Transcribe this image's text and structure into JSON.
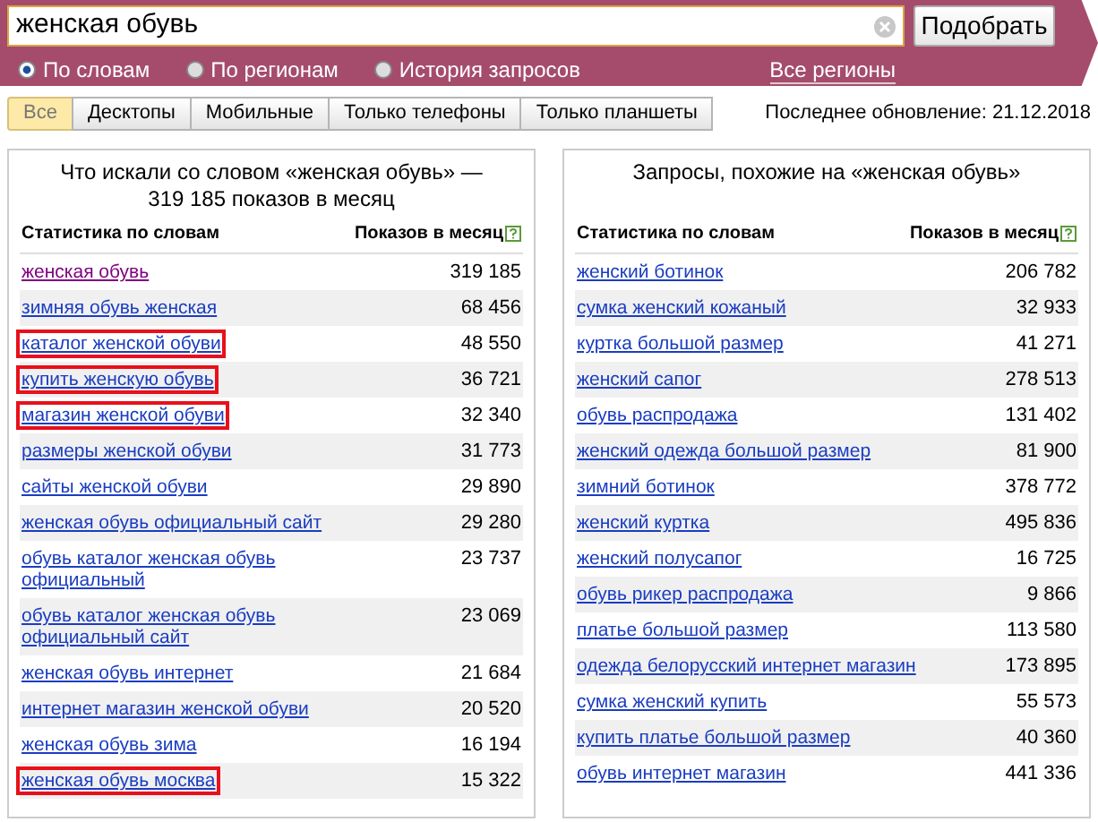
{
  "search": {
    "value": "женская обувь",
    "button": "Подобрать"
  },
  "modes": [
    {
      "label": "По словам",
      "selected": true
    },
    {
      "label": "По регионам",
      "selected": false
    },
    {
      "label": "История запросов",
      "selected": false
    }
  ],
  "regions_link": "Все регионы",
  "tabs": [
    {
      "label": "Все",
      "selected": true
    },
    {
      "label": "Десктопы",
      "selected": false
    },
    {
      "label": "Мобильные",
      "selected": false
    },
    {
      "label": "Только телефоны",
      "selected": false
    },
    {
      "label": "Только планшеты",
      "selected": false
    }
  ],
  "last_update": "Последнее обновление: 21.12.2018",
  "panels": [
    {
      "title": "Что искали со словом «женская обувь» — 319 185 показов в месяц",
      "columns": [
        "Статистика по словам",
        "Показов в месяц"
      ],
      "rows": [
        {
          "query": "женская обувь",
          "shows": "319 185",
          "visited": true,
          "highlighted": false
        },
        {
          "query": "зимняя обувь женская",
          "shows": "68 456",
          "visited": false,
          "highlighted": false
        },
        {
          "query": "каталог женской обуви",
          "shows": "48 550",
          "visited": false,
          "highlighted": true
        },
        {
          "query": "купить женскую обувь",
          "shows": "36 721",
          "visited": false,
          "highlighted": true
        },
        {
          "query": "магазин женской обуви",
          "shows": "32 340",
          "visited": false,
          "highlighted": true
        },
        {
          "query": "размеры женской обуви",
          "shows": "31 773",
          "visited": false,
          "highlighted": false
        },
        {
          "query": "сайты женской обуви",
          "shows": "29 890",
          "visited": false,
          "highlighted": false
        },
        {
          "query": "женская обувь официальный сайт",
          "shows": "29 280",
          "visited": false,
          "highlighted": false
        },
        {
          "query": "обувь каталог женская обувь официальный",
          "shows": "23 737",
          "visited": false,
          "highlighted": false
        },
        {
          "query": "обувь каталог женская обувь официальный сайт",
          "shows": "23 069",
          "visited": false,
          "highlighted": false
        },
        {
          "query": "женская обувь интернет",
          "shows": "21 684",
          "visited": false,
          "highlighted": false
        },
        {
          "query": "интернет магазин женской обуви",
          "shows": "20 520",
          "visited": false,
          "highlighted": false
        },
        {
          "query": "женская обувь зима",
          "shows": "16 194",
          "visited": false,
          "highlighted": false
        },
        {
          "query": "женская обувь москва",
          "shows": "15 322",
          "visited": false,
          "highlighted": true
        }
      ]
    },
    {
      "title": "Запросы, похожие на «женская обувь»",
      "columns": [
        "Статистика по словам",
        "Показов в месяц"
      ],
      "rows": [
        {
          "query": "женский ботинок",
          "shows": "206 782"
        },
        {
          "query": "сумка женский кожаный",
          "shows": "32 933"
        },
        {
          "query": "куртка большой размер",
          "shows": "41 271"
        },
        {
          "query": "женский сапог",
          "shows": "278 513"
        },
        {
          "query": "обувь распродажа",
          "shows": "131 402"
        },
        {
          "query": "женский одежда большой размер",
          "shows": "81 900"
        },
        {
          "query": "зимний ботинок",
          "shows": "378 772"
        },
        {
          "query": "женский куртка",
          "shows": "495 836"
        },
        {
          "query": "женский полусапог",
          "shows": "16 725"
        },
        {
          "query": "обувь рикер распродажа",
          "shows": "9 866"
        },
        {
          "query": "платье большой размер",
          "shows": "113 580"
        },
        {
          "query": "одежда белорусский интернет магазин",
          "shows": "173 895"
        },
        {
          "query": "сумка женский купить",
          "shows": "55 573"
        },
        {
          "query": "купить платье большой размер",
          "shows": "40 360"
        },
        {
          "query": "обувь интернет магазин",
          "shows": "441 336"
        }
      ]
    }
  ]
}
